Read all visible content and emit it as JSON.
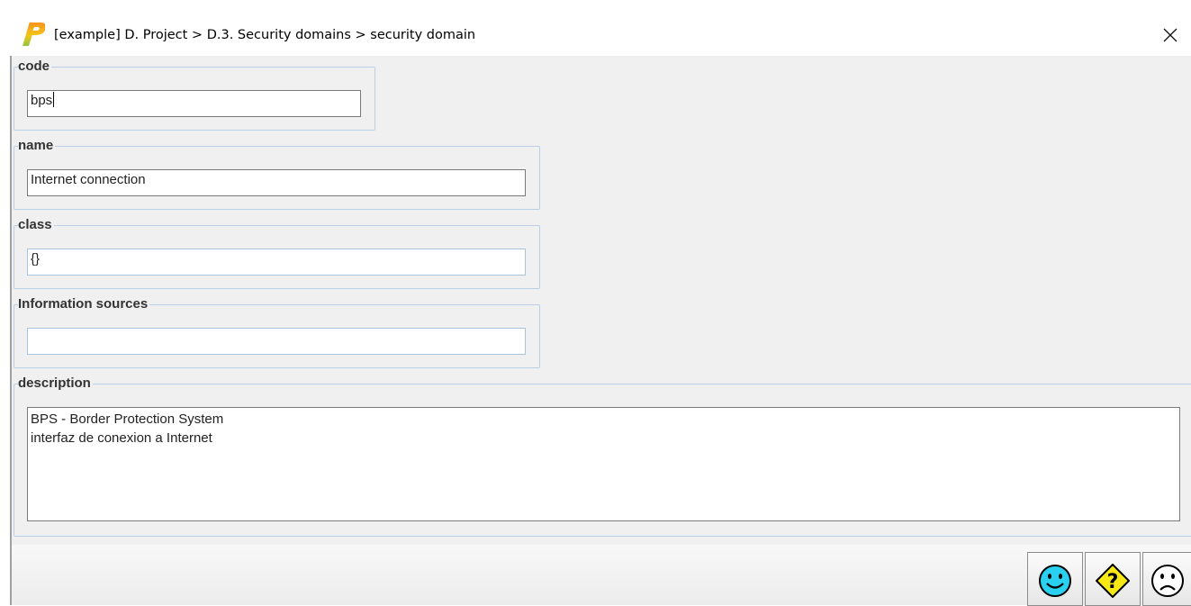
{
  "window": {
    "title": "[example] D. Project > D.3. Security domains > security domain",
    "logo_letter": "P",
    "close_glyph": "×"
  },
  "form": {
    "code": {
      "label": "code",
      "value": "bps"
    },
    "name": {
      "label": "name",
      "value": "Internet connection"
    },
    "class": {
      "label": "class",
      "value": "{}"
    },
    "information_sources": {
      "label": "Information sources",
      "value": ""
    },
    "description": {
      "label": "description",
      "value": "BPS - Border Protection System\ninterfaz de conexion a Internet"
    }
  },
  "buttons": {
    "ok": {
      "icon": "smiley-happy-icon",
      "color": "#29d0f0"
    },
    "help": {
      "icon": "question-diamond-icon",
      "color": "#f7ea14"
    },
    "cancel": {
      "icon": "smiley-sad-icon",
      "color": "#ffffff"
    }
  },
  "colors": {
    "panel_bg": "#f0f0f0",
    "group_border": "#b8cfe5",
    "accent_orange": "#f08a1a",
    "accent_green": "#7bc043"
  }
}
